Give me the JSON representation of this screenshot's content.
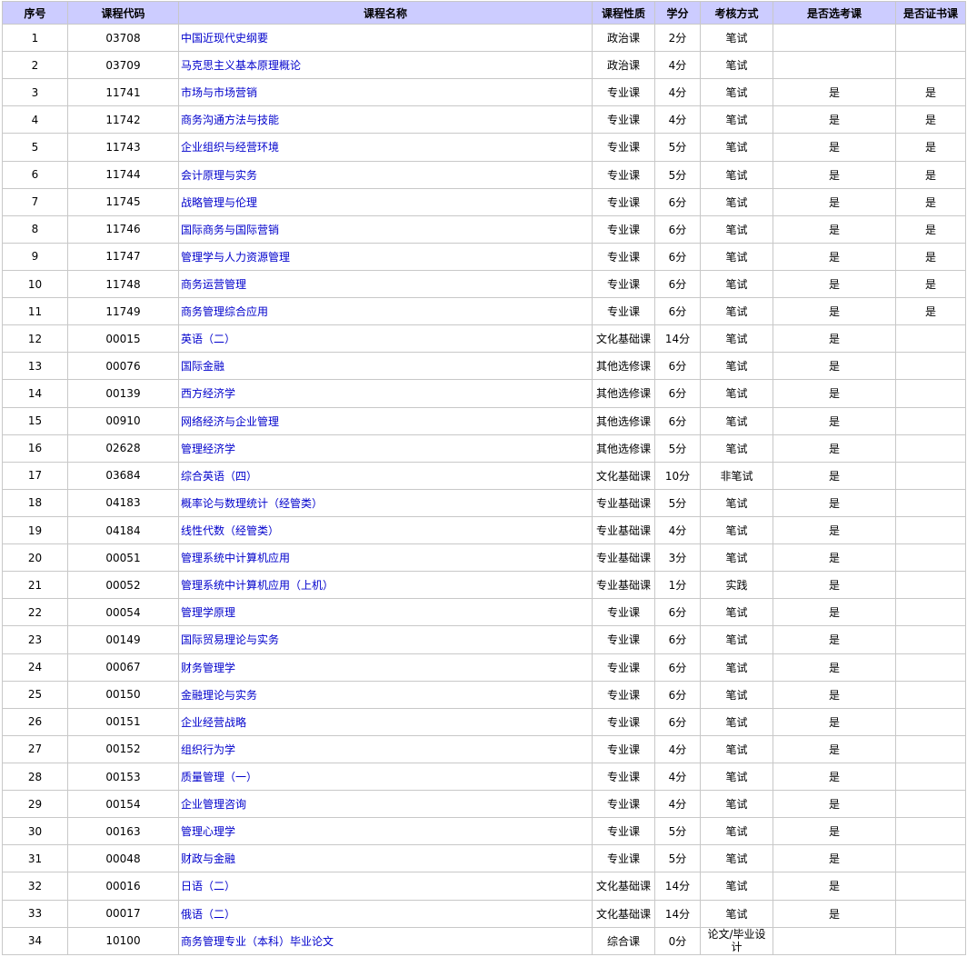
{
  "table": {
    "headers": [
      "序号",
      "课程代码",
      "课程名称",
      "课程性质",
      "学分",
      "考核方式",
      "是否选考课",
      "是否证书课"
    ],
    "rows": [
      [
        "1",
        "03708",
        "中国近现代史纲要",
        "政治课",
        "2分",
        "笔试",
        "",
        ""
      ],
      [
        "2",
        "03709",
        "马克思主义基本原理概论",
        "政治课",
        "4分",
        "笔试",
        "",
        ""
      ],
      [
        "3",
        "11741",
        "市场与市场营销",
        "专业课",
        "4分",
        "笔试",
        "是",
        "是"
      ],
      [
        "4",
        "11742",
        "商务沟通方法与技能",
        "专业课",
        "4分",
        "笔试",
        "是",
        "是"
      ],
      [
        "5",
        "11743",
        "企业组织与经营环境",
        "专业课",
        "5分",
        "笔试",
        "是",
        "是"
      ],
      [
        "6",
        "11744",
        "会计原理与实务",
        "专业课",
        "5分",
        "笔试",
        "是",
        "是"
      ],
      [
        "7",
        "11745",
        "战略管理与伦理",
        "专业课",
        "6分",
        "笔试",
        "是",
        "是"
      ],
      [
        "8",
        "11746",
        "国际商务与国际营销",
        "专业课",
        "6分",
        "笔试",
        "是",
        "是"
      ],
      [
        "9",
        "11747",
        "管理学与人力资源管理",
        "专业课",
        "6分",
        "笔试",
        "是",
        "是"
      ],
      [
        "10",
        "11748",
        "商务运营管理",
        "专业课",
        "6分",
        "笔试",
        "是",
        "是"
      ],
      [
        "11",
        "11749",
        "商务管理综合应用",
        "专业课",
        "6分",
        "笔试",
        "是",
        "是"
      ],
      [
        "12",
        "00015",
        "英语（二）",
        "文化基础课",
        "14分",
        "笔试",
        "是",
        ""
      ],
      [
        "13",
        "00076",
        "国际金融",
        "其他选修课",
        "6分",
        "笔试",
        "是",
        ""
      ],
      [
        "14",
        "00139",
        "西方经济学",
        "其他选修课",
        "6分",
        "笔试",
        "是",
        ""
      ],
      [
        "15",
        "00910",
        "网络经济与企业管理",
        "其他选修课",
        "6分",
        "笔试",
        "是",
        ""
      ],
      [
        "16",
        "02628",
        "管理经济学",
        "其他选修课",
        "5分",
        "笔试",
        "是",
        ""
      ],
      [
        "17",
        "03684",
        "综合英语（四）",
        "文化基础课",
        "10分",
        "非笔试",
        "是",
        ""
      ],
      [
        "18",
        "04183",
        "概率论与数理统计（经管类）",
        "专业基础课",
        "5分",
        "笔试",
        "是",
        ""
      ],
      [
        "19",
        "04184",
        "线性代数（经管类）",
        "专业基础课",
        "4分",
        "笔试",
        "是",
        ""
      ],
      [
        "20",
        "00051",
        "管理系统中计算机应用",
        "专业基础课",
        "3分",
        "笔试",
        "是",
        ""
      ],
      [
        "21",
        "00052",
        "管理系统中计算机应用（上机）",
        "专业基础课",
        "1分",
        "实践",
        "是",
        ""
      ],
      [
        "22",
        "00054",
        "管理学原理",
        "专业课",
        "6分",
        "笔试",
        "是",
        ""
      ],
      [
        "23",
        "00149",
        "国际贸易理论与实务",
        "专业课",
        "6分",
        "笔试",
        "是",
        ""
      ],
      [
        "24",
        "00067",
        "财务管理学",
        "专业课",
        "6分",
        "笔试",
        "是",
        ""
      ],
      [
        "25",
        "00150",
        "金融理论与实务",
        "专业课",
        "6分",
        "笔试",
        "是",
        ""
      ],
      [
        "26",
        "00151",
        "企业经营战略",
        "专业课",
        "6分",
        "笔试",
        "是",
        ""
      ],
      [
        "27",
        "00152",
        "组织行为学",
        "专业课",
        "4分",
        "笔试",
        "是",
        ""
      ],
      [
        "28",
        "00153",
        "质量管理（一）",
        "专业课",
        "4分",
        "笔试",
        "是",
        ""
      ],
      [
        "29",
        "00154",
        "企业管理咨询",
        "专业课",
        "4分",
        "笔试",
        "是",
        ""
      ],
      [
        "30",
        "00163",
        "管理心理学",
        "专业课",
        "5分",
        "笔试",
        "是",
        ""
      ],
      [
        "31",
        "00048",
        "财政与金融",
        "专业课",
        "5分",
        "笔试",
        "是",
        ""
      ],
      [
        "32",
        "00016",
        "日语（二）",
        "文化基础课",
        "14分",
        "笔试",
        "是",
        ""
      ],
      [
        "33",
        "00017",
        "俄语（二）",
        "文化基础课",
        "14分",
        "笔试",
        "是",
        ""
      ],
      [
        "34",
        "10100",
        "商务管理专业（本科）毕业论文",
        "综合课",
        "0分",
        "论文/毕业设计",
        "",
        ""
      ]
    ]
  },
  "colors": {
    "header_bg": "#ccccff",
    "link": "#0000cc",
    "border": "#c8c8c8"
  }
}
